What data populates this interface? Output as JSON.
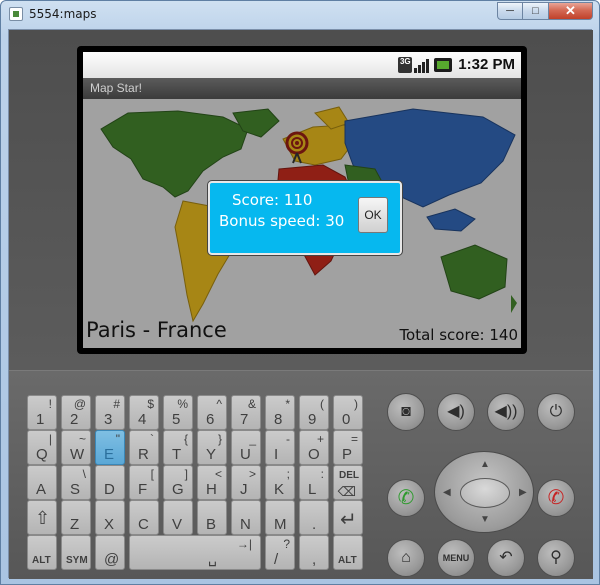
{
  "window": {
    "title": "5554:maps",
    "min_glyph": "─",
    "max_glyph": "□",
    "close_glyph": "✕"
  },
  "statusbar": {
    "network": "3G",
    "time": "1:32 PM"
  },
  "app": {
    "title": "Map Star!",
    "city": "Paris - France",
    "total_score": "Total score: 140"
  },
  "dialog": {
    "score": "Score: 110",
    "bonus": "Bonus speed: 30",
    "ok": "OK"
  },
  "keyboard": {
    "rows": [
      [
        {
          "k": "1",
          "s": "!"
        },
        {
          "k": "2",
          "s": "@"
        },
        {
          "k": "3",
          "s": "#"
        },
        {
          "k": "4",
          "s": "$"
        },
        {
          "k": "5",
          "s": "%"
        },
        {
          "k": "6",
          "s": "^"
        },
        {
          "k": "7",
          "s": "&"
        },
        {
          "k": "8",
          "s": "*"
        },
        {
          "k": "9",
          "s": "("
        },
        {
          "k": "0",
          "s": ")"
        }
      ],
      [
        {
          "k": "Q",
          "s": "|"
        },
        {
          "k": "W",
          "s": "~"
        },
        {
          "k": "E",
          "s": "\""
        },
        {
          "k": "R",
          "s": "`"
        },
        {
          "k": "T",
          "s": "{"
        },
        {
          "k": "Y",
          "s": "}"
        },
        {
          "k": "U",
          "s": "_"
        },
        {
          "k": "I",
          "s": "-"
        },
        {
          "k": "O",
          "s": "+"
        },
        {
          "k": "P",
          "s": "="
        }
      ],
      [
        {
          "k": "A",
          "s": ""
        },
        {
          "k": "S",
          "s": "\\"
        },
        {
          "k": "D",
          "s": ""
        },
        {
          "k": "F",
          "s": "["
        },
        {
          "k": "G",
          "s": "]"
        },
        {
          "k": "H",
          "s": "<"
        },
        {
          "k": "J",
          "s": ">"
        },
        {
          "k": "K",
          "s": ";"
        },
        {
          "k": "L",
          "s": ":"
        },
        {
          "k": "DEL",
          "s": ""
        }
      ],
      [
        {
          "k": "⇧",
          "s": ""
        },
        {
          "k": "Z",
          "s": ""
        },
        {
          "k": "X",
          "s": ""
        },
        {
          "k": "C",
          "s": ""
        },
        {
          "k": "V",
          "s": ""
        },
        {
          "k": "B",
          "s": ""
        },
        {
          "k": "N",
          "s": ""
        },
        {
          "k": "M",
          "s": ""
        },
        {
          "k": ".",
          "s": ""
        },
        {
          "k": "↵",
          "s": ""
        }
      ],
      [
        {
          "k": "ALT",
          "s": ""
        },
        {
          "k": "SYM",
          "s": ""
        },
        {
          "k": "@",
          "s": ""
        },
        {
          "k": "␣",
          "s": "→|"
        },
        {
          "k": "/",
          "s": "?"
        },
        {
          "k": ",",
          "s": ""
        },
        {
          "k": "ALT",
          "s": ""
        }
      ]
    ],
    "selected_key": "E"
  },
  "buttons": {
    "camera": "camera-icon",
    "volume_down": "volume-down-icon",
    "volume_up": "volume-up-icon",
    "power": "power-icon",
    "call": "call-icon",
    "end_call": "end-call-icon",
    "home": "home-icon",
    "menu": "MENU",
    "back": "back-icon",
    "search": "search-icon"
  },
  "colors": {
    "dialog_bg": "#06b8ef",
    "selected_key": "#5aa7d6",
    "call_green": "#2f9a2f",
    "end_red": "#c62424"
  }
}
